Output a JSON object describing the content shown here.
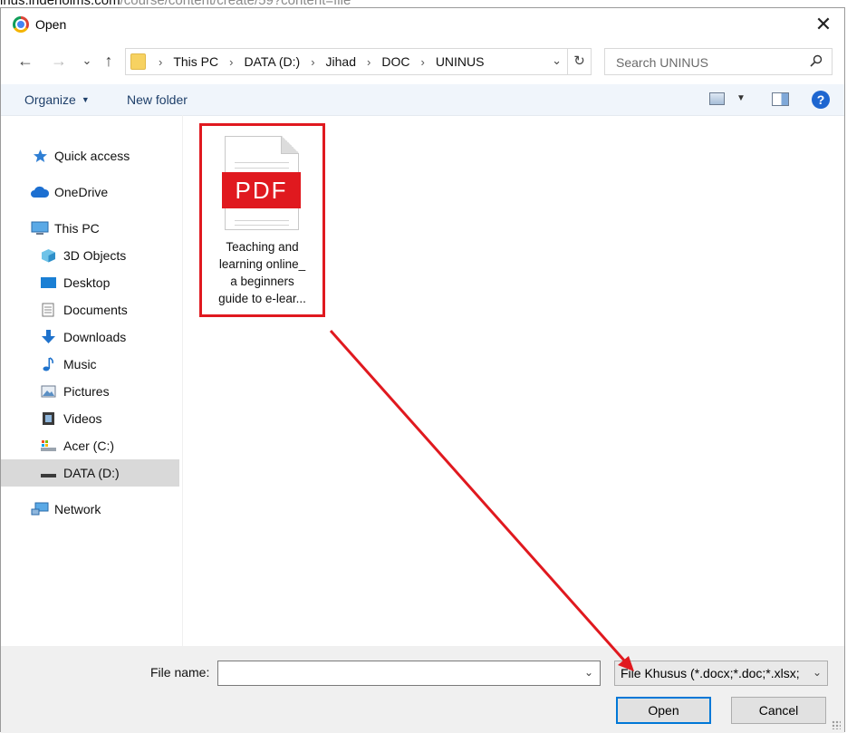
{
  "background_page": {
    "url_host": "inus.indehoims.com",
    "url_path": "/course/content/create/59?content=file"
  },
  "window": {
    "title": "Open",
    "close_glyph": "✕"
  },
  "nav": {
    "back": "←",
    "forward": "→",
    "recent": "⌄",
    "up": "↑"
  },
  "address": {
    "crumbs": [
      "This PC",
      "DATA (D:)",
      "Jihad",
      "DOC",
      "UNINUS"
    ],
    "separator": "›",
    "dropdown_glyph": "⌄",
    "refresh_glyph": "↻"
  },
  "search": {
    "placeholder": "Search UNINUS"
  },
  "toolbar": {
    "organize": "Organize",
    "new_folder": "New folder",
    "help": "?"
  },
  "sidebar": {
    "items": [
      {
        "label": "Quick access",
        "icon": "star-icon"
      },
      {
        "label": "OneDrive",
        "icon": "cloud-icon"
      },
      {
        "label": "This PC",
        "icon": "computer-icon"
      },
      {
        "label": "3D Objects",
        "icon": "cube-icon"
      },
      {
        "label": "Desktop",
        "icon": "desktop-icon"
      },
      {
        "label": "Documents",
        "icon": "document-icon"
      },
      {
        "label": "Downloads",
        "icon": "download-icon"
      },
      {
        "label": "Music",
        "icon": "music-icon"
      },
      {
        "label": "Pictures",
        "icon": "picture-icon"
      },
      {
        "label": "Videos",
        "icon": "video-icon"
      },
      {
        "label": "Acer (C:)",
        "icon": "drive-icon"
      },
      {
        "label": "DATA (D:)",
        "icon": "drive-icon",
        "selected": true
      },
      {
        "label": "Network",
        "icon": "network-icon"
      }
    ]
  },
  "files": [
    {
      "badge": "PDF",
      "name_lines": [
        "Teaching and",
        "learning online_",
        "a beginners",
        "guide to e-lear..."
      ]
    }
  ],
  "bottom": {
    "file_name_label": "File name:",
    "file_name_value": "",
    "file_type_filter": "File Khusus (*.docx;*.doc;*.xlsx;",
    "open_label": "Open",
    "cancel_label": "Cancel"
  },
  "colors": {
    "highlight_red": "#e0191f",
    "accent_blue": "#0078d7",
    "help_blue": "#1e66d0"
  }
}
